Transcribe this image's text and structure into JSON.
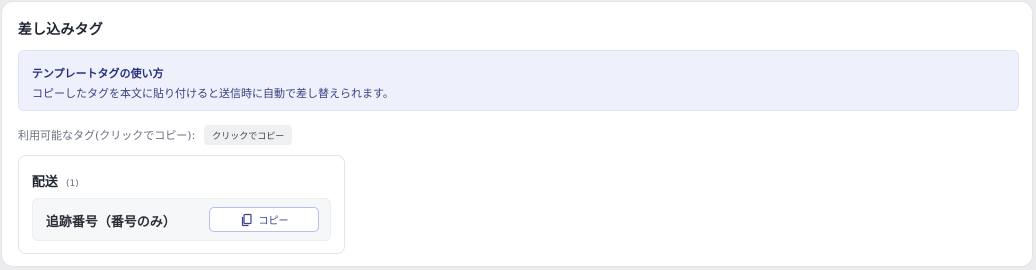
{
  "panel": {
    "title": "差し込みタグ"
  },
  "info": {
    "title": "テンプレートタグの使い方",
    "description": "コピーしたタグを本文に貼り付けると送信時に自動で差し替えられます。"
  },
  "available": {
    "label": "利用可能なタグ(クリックでコピー):",
    "chip_label": "クリックでコピー"
  },
  "groups": [
    {
      "name": "配送",
      "count": "(1)",
      "tags": [
        {
          "label": "追跡番号（番号のみ）",
          "button_label": "コピー",
          "icon": "copy-icon"
        }
      ]
    }
  ],
  "colors": {
    "accent": "#3b3f8f",
    "info_bg": "#eef0fc",
    "button_border": "#b8bdf0"
  }
}
